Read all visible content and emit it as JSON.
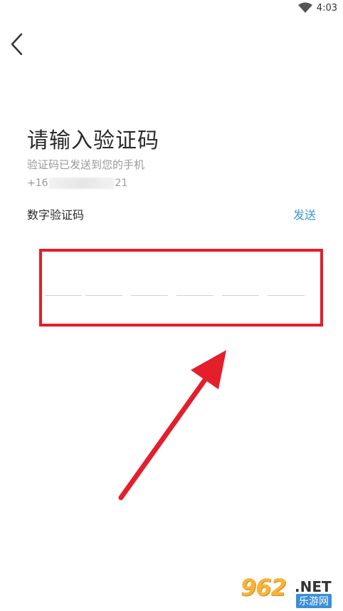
{
  "status_bar": {
    "time": "4:03"
  },
  "header": {
    "back_icon": "chevron-left-icon"
  },
  "main": {
    "title": "请输入验证码",
    "subtitle": "验证码已发送到您的手机",
    "phone_prefix": "+16",
    "phone_suffix": "21",
    "code_label": "数字验证码",
    "send_label": "发送",
    "code_slot_count": 6
  },
  "colors": {
    "accent": "#3a98d6",
    "annotation": "#e41e2b"
  },
  "watermark": {
    "brand": "962",
    "tld": ".NET",
    "subtitle": "乐游网"
  }
}
